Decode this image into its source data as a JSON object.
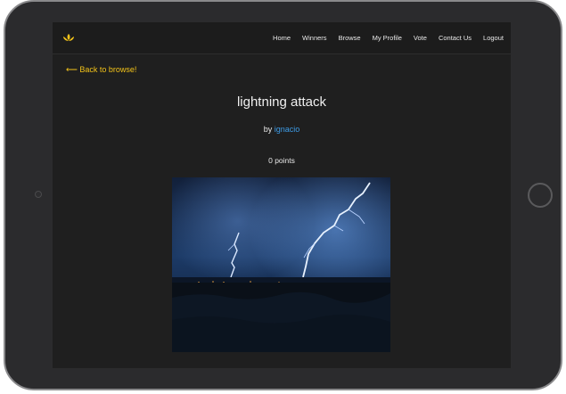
{
  "nav": {
    "items": [
      "Home",
      "Winners",
      "Browse",
      "My Profile",
      "Vote",
      "Contact Us",
      "Logout"
    ]
  },
  "back_link": "⟵ Back to browse!",
  "post": {
    "title": "lightning attack",
    "by_prefix": "by ",
    "author": "ignacio",
    "points": "0 points"
  },
  "colors": {
    "accent": "#f3c319",
    "link": "#3d9be6",
    "background": "#1f1f1f"
  },
  "icons": {
    "logo": "lotus-icon"
  }
}
